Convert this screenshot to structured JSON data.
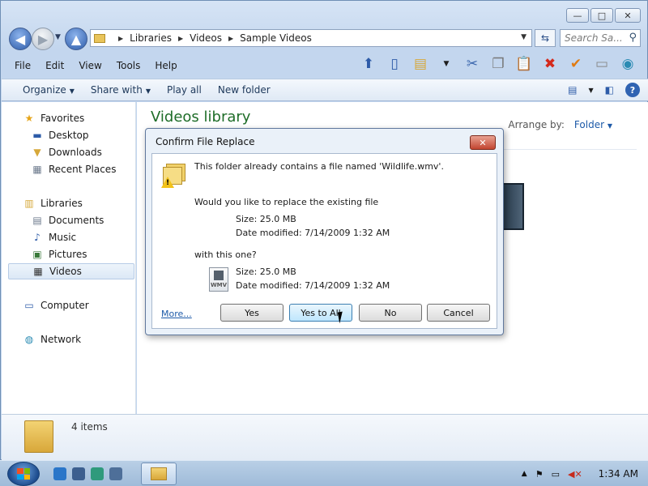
{
  "window": {
    "controls": {
      "minimize": "—",
      "maximize": "□",
      "close": "✕"
    }
  },
  "address": {
    "breadcrumbs": [
      "Libraries",
      "Videos",
      "Sample Videos"
    ],
    "search_placeholder": "Search Sa..."
  },
  "menu": {
    "items": [
      "File",
      "Edit",
      "View",
      "Tools",
      "Help"
    ]
  },
  "commands": {
    "organize": "Organize",
    "share_with": "Share with",
    "play_all": "Play all",
    "new_folder": "New folder"
  },
  "sidebar": {
    "favorites_header": "Favorites",
    "favorites": [
      "Desktop",
      "Downloads",
      "Recent Places"
    ],
    "libraries_header": "Libraries",
    "libraries": [
      "Documents",
      "Music",
      "Pictures",
      "Videos"
    ],
    "selected": "Videos",
    "computer": "Computer",
    "network": "Network"
  },
  "content": {
    "library_title": "Videos library",
    "arrange_label": "Arrange by:",
    "arrange_value": "Folder"
  },
  "details": {
    "item_count": "4 items"
  },
  "dialog": {
    "title": "Confirm File Replace",
    "message": "This folder already contains a file named 'Wildlife.wmv'.",
    "question": "Would you like to replace the existing file",
    "existing_size": "Size: 25.0 MB",
    "existing_modified": "Date modified: 7/14/2009 1:32 AM",
    "with_this": "with this one?",
    "new_size": "Size: 25.0 MB",
    "new_modified": "Date modified: 7/14/2009 1:32 AM",
    "file_icon_label": "WMV",
    "more_link": "More...",
    "buttons": {
      "yes": "Yes",
      "yes_to_all": "Yes to All",
      "no": "No",
      "cancel": "Cancel"
    }
  },
  "taskbar": {
    "clock": "1:34 AM"
  },
  "colors": {
    "library_title": "#1e6d28",
    "link": "#1d5aa8",
    "dialog_close": "#c24530"
  }
}
